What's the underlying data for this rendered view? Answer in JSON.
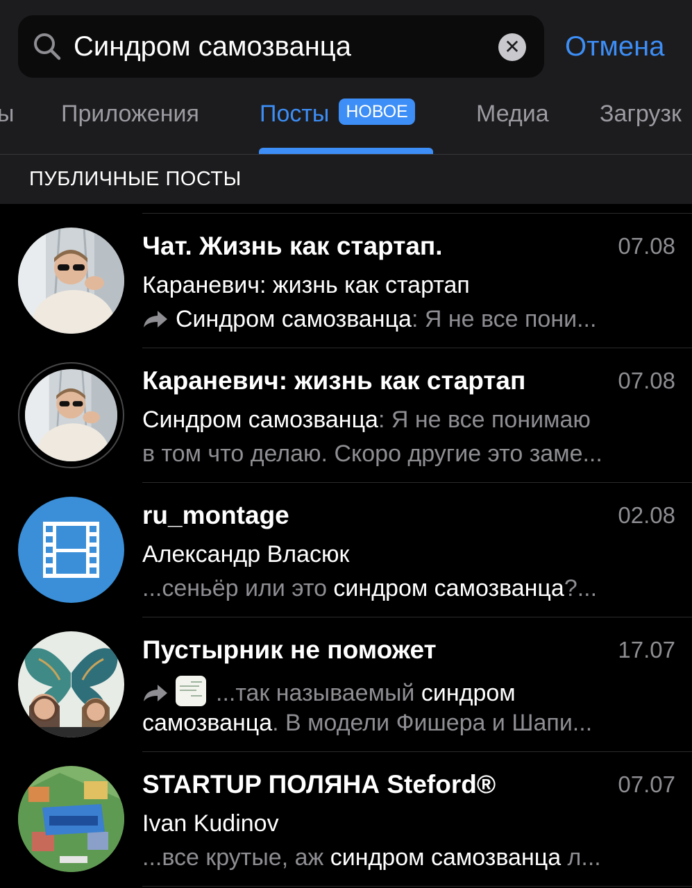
{
  "search": {
    "query": "Синдром самозванца",
    "cancel_label": "Отмена"
  },
  "tabs": {
    "items": [
      {
        "label": "ы"
      },
      {
        "label": "Приложения"
      },
      {
        "label": "Посты",
        "badge": "НОВОЕ",
        "active": true
      },
      {
        "label": "Медиа"
      },
      {
        "label": "Загрузк"
      }
    ]
  },
  "section": {
    "title": "ПУБЛИЧНЫЕ ПОСТЫ"
  },
  "results": [
    {
      "title": "Чат. Жизнь как стартап.",
      "date": "07.08",
      "line1": "Караневич: жизнь как стартап",
      "line2_lead": "Синдром самозванца",
      "line2_muted": ": Я не все пони...",
      "forwarded": true,
      "avatar": "person-photo"
    },
    {
      "title": "Караневич: жизнь как стартап",
      "date": "07.08",
      "line1_lead": "Синдром самозванца",
      "line1_muted": ": Я не все понимаю",
      "line2_muted": "в том что делаю. Скоро другие это заме...",
      "avatar": "person-photo-story"
    },
    {
      "title": "ru_montage",
      "date": "02.08",
      "line1": "Александр Власюк",
      "line2_muted": "...сеньёр или это ",
      "line2_highlight": "синдром самозванца",
      "line2_tail": "?...",
      "avatar": "film-icon",
      "avatar_color": "#3a8fd8"
    },
    {
      "title": "Пустырник не поможет",
      "date": "17.07",
      "line1_muted": "...так называемый ",
      "line1_highlight": "синдром",
      "line2_lead": "самозванца",
      "line2_muted": ". В модели Фишера и Шапи...",
      "forwarded": true,
      "avatar": "butterfly-art"
    },
    {
      "title": "STARTUP ПОЛЯНА Steford®",
      "date": "07.07",
      "line1": "Ivan Kudinov",
      "line2_muted": "...все крутые, аж ",
      "line2_highlight": "синдром самозванца",
      "line2_tail": " л...",
      "avatar": "startup-city-art"
    }
  ]
}
